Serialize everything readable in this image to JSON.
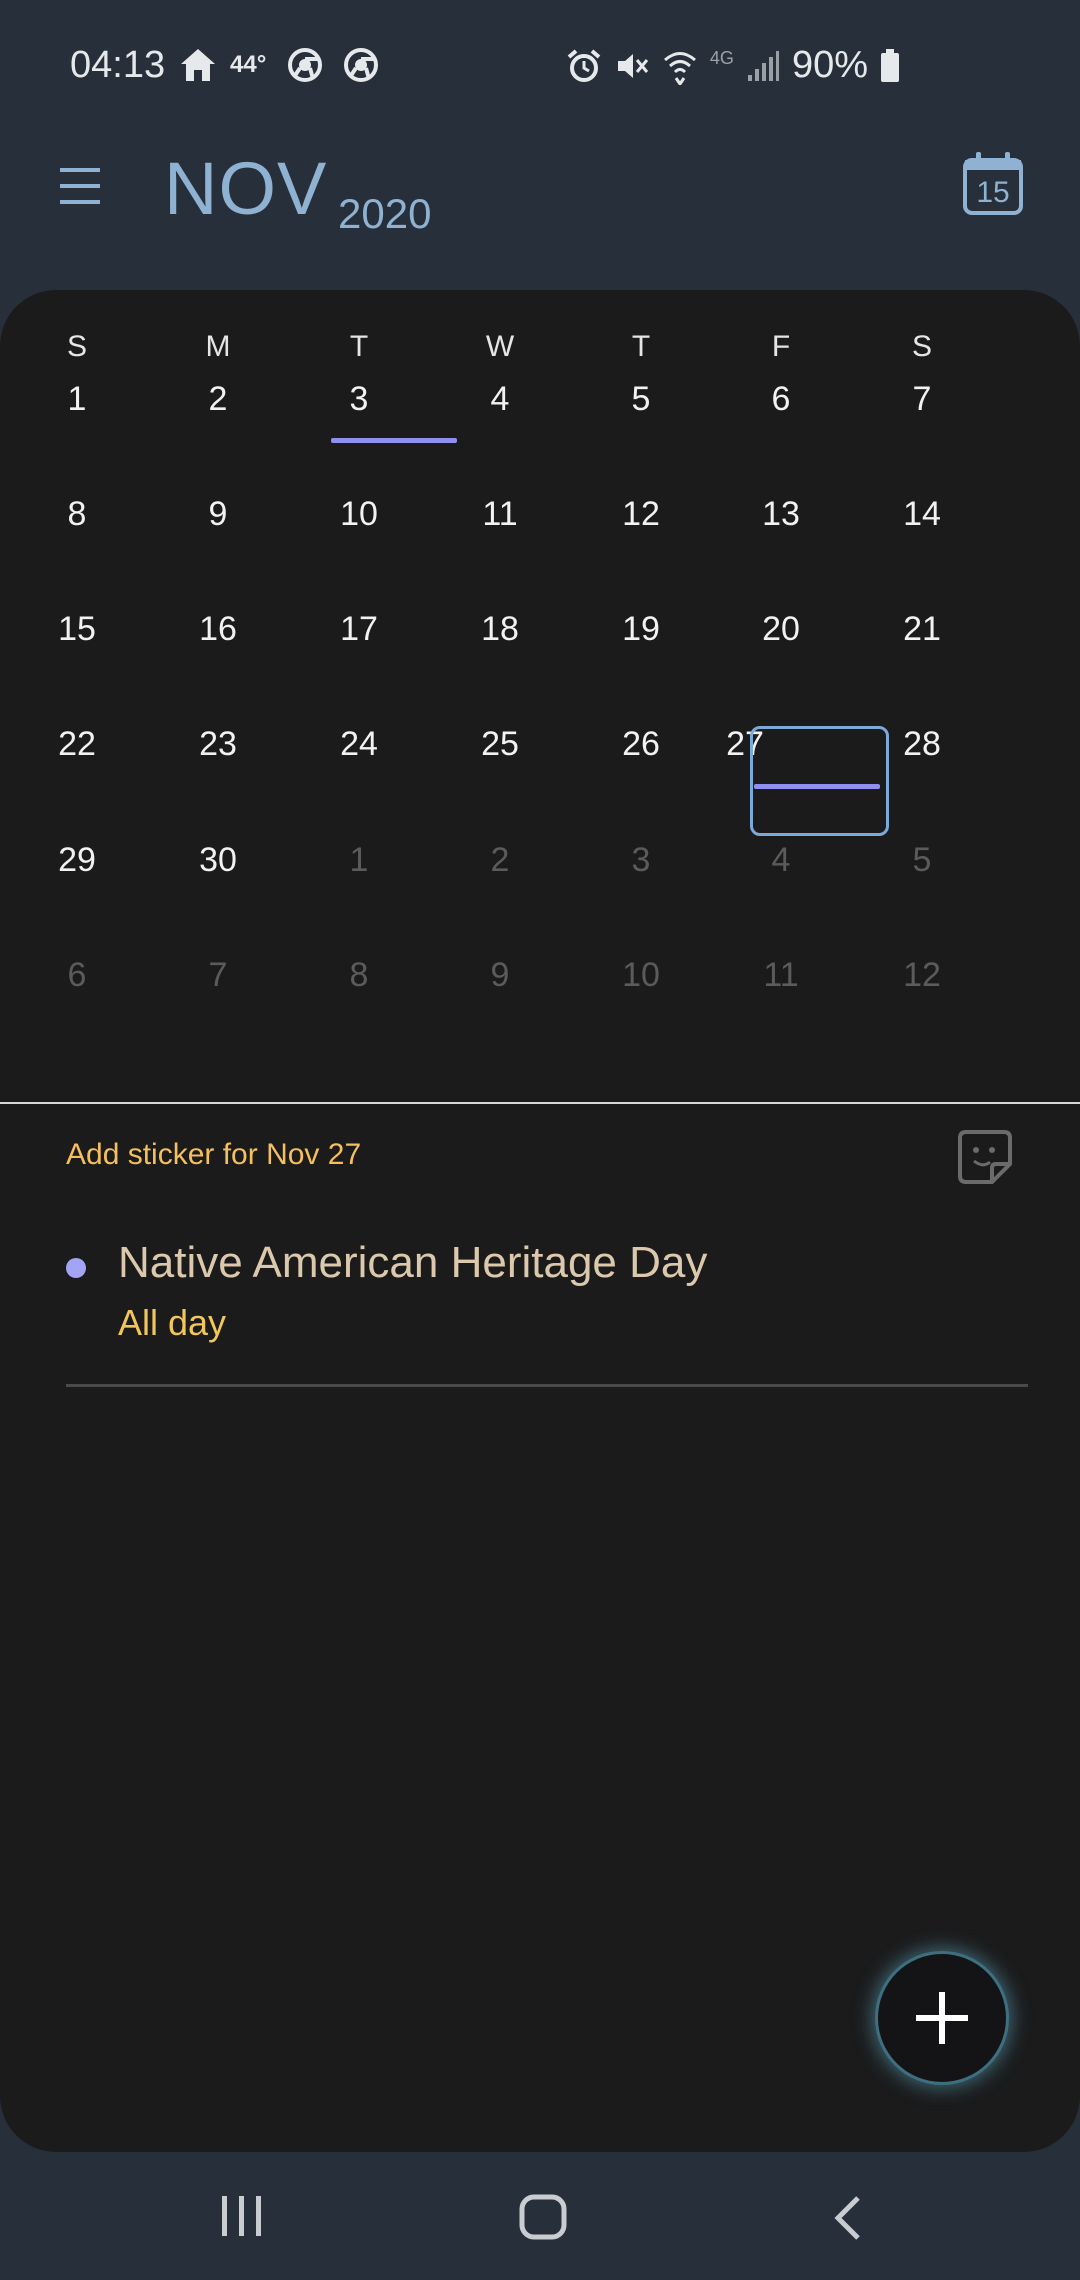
{
  "status_bar": {
    "time": "04:13",
    "temperature": "44°",
    "battery": "90%",
    "network": "4G",
    "icons_left": [
      "home-icon",
      "chrome-icon",
      "chrome-icon"
    ],
    "icons_right": [
      "alarm-icon",
      "mute-icon",
      "wifi-icon",
      "signal-icon",
      "battery-icon"
    ]
  },
  "header": {
    "month": "NOV",
    "year": "2020",
    "today_button": "15"
  },
  "calendar": {
    "weekdays": [
      "S",
      "M",
      "T",
      "W",
      "T",
      "F",
      "S"
    ],
    "weeks": [
      [
        {
          "d": "1"
        },
        {
          "d": "2"
        },
        {
          "d": "3",
          "today": true
        },
        {
          "d": "4"
        },
        {
          "d": "5"
        },
        {
          "d": "6"
        },
        {
          "d": "7"
        }
      ],
      [
        {
          "d": "8"
        },
        {
          "d": "9"
        },
        {
          "d": "10"
        },
        {
          "d": "11"
        },
        {
          "d": "12"
        },
        {
          "d": "13"
        },
        {
          "d": "14"
        }
      ],
      [
        {
          "d": "15"
        },
        {
          "d": "16"
        },
        {
          "d": "17"
        },
        {
          "d": "18"
        },
        {
          "d": "19"
        },
        {
          "d": "20"
        },
        {
          "d": "21"
        }
      ],
      [
        {
          "d": "22"
        },
        {
          "d": "23"
        },
        {
          "d": "24"
        },
        {
          "d": "25"
        },
        {
          "d": "26"
        },
        {
          "d": "27",
          "selected": true
        },
        {
          "d": "28"
        }
      ],
      [
        {
          "d": "29"
        },
        {
          "d": "30"
        },
        {
          "d": "1",
          "other": true
        },
        {
          "d": "2",
          "other": true
        },
        {
          "d": "3",
          "other": true
        },
        {
          "d": "4",
          "other": true
        },
        {
          "d": "5",
          "other": true
        }
      ],
      [
        {
          "d": "6",
          "other": true
        },
        {
          "d": "7",
          "other": true
        },
        {
          "d": "8",
          "other": true
        },
        {
          "d": "9",
          "other": true
        },
        {
          "d": "10",
          "other": true
        },
        {
          "d": "11",
          "other": true
        },
        {
          "d": "12",
          "other": true
        }
      ]
    ],
    "event_marker_color": "#8f8ff0"
  },
  "detail": {
    "sticker_label": "Add sticker for Nov 27",
    "events": [
      {
        "title": "Native American Heritage Day",
        "time": "All day",
        "color": "#a4a4f5"
      }
    ]
  },
  "colors": {
    "background": "#27303a",
    "card": "#1b1b1c",
    "accent": "#8fb1d2",
    "sticker_text": "#f4bf5c"
  }
}
